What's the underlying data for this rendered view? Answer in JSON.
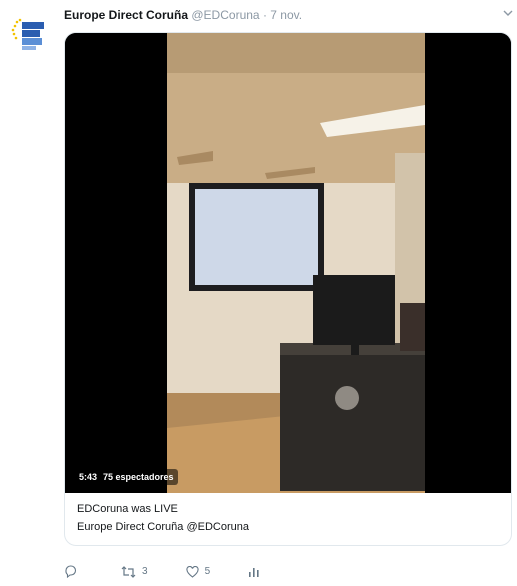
{
  "tweet": {
    "author_name": "Europe Direct Coruña",
    "author_handle": "@EDCoruna",
    "separator": "·",
    "timestamp": "7 nov.",
    "caret_icon": "chevron-down-icon"
  },
  "video": {
    "duration": "5:43",
    "viewers": "75 espectadores"
  },
  "card": {
    "title": "EDCoruna was LIVE",
    "subtitle": "Europe Direct Coruña @EDCoruna"
  },
  "actions": {
    "reply_count": "",
    "retweet_count": "3",
    "like_count": "5",
    "reply_icon": "reply-icon",
    "retweet_icon": "retweet-icon",
    "like_icon": "heart-icon",
    "analytics_icon": "analytics-icon"
  },
  "colors": {
    "text_primary": "#14171a",
    "text_secondary": "#657786",
    "border": "#e1e8ed",
    "brand_blue": "#2a5db0",
    "brand_yellow": "#f2c200"
  }
}
